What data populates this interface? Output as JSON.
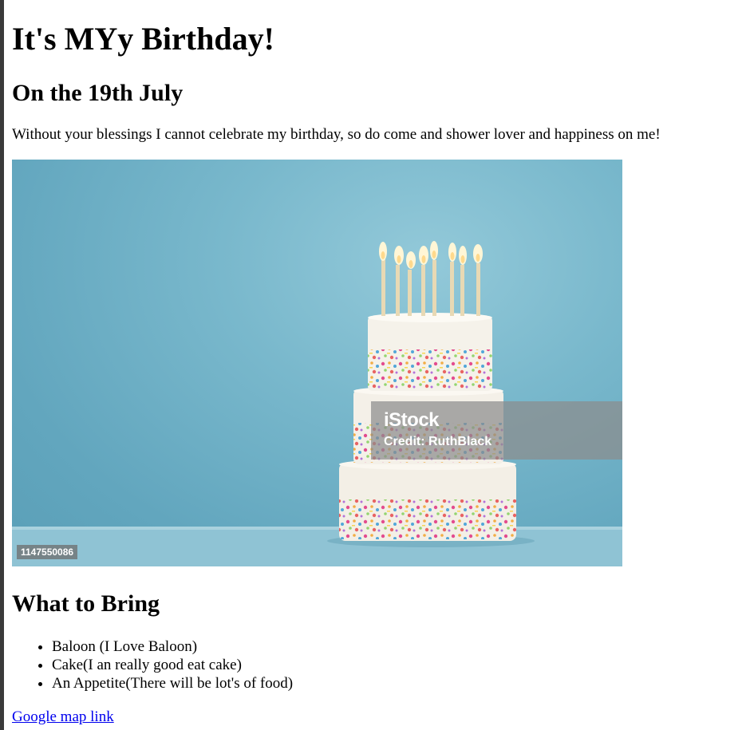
{
  "page": {
    "title": "It's MYy Birthday!",
    "date_heading": "On the 19th July",
    "intro": "Without your blessings I cannot celebrate my birthday, so do come and shower lover and happiness on me!"
  },
  "image": {
    "watermark_brand": "iStock",
    "watermark_credit": "Credit: RuthBlack",
    "image_id": "1147550086"
  },
  "bring": {
    "heading": "What to Bring",
    "items": [
      "Baloon (I Love Baloon)",
      "Cake(I an really good eat cake)",
      "An Appetite(There will be lot's of food)"
    ]
  },
  "links": {
    "map": "Google map link"
  }
}
